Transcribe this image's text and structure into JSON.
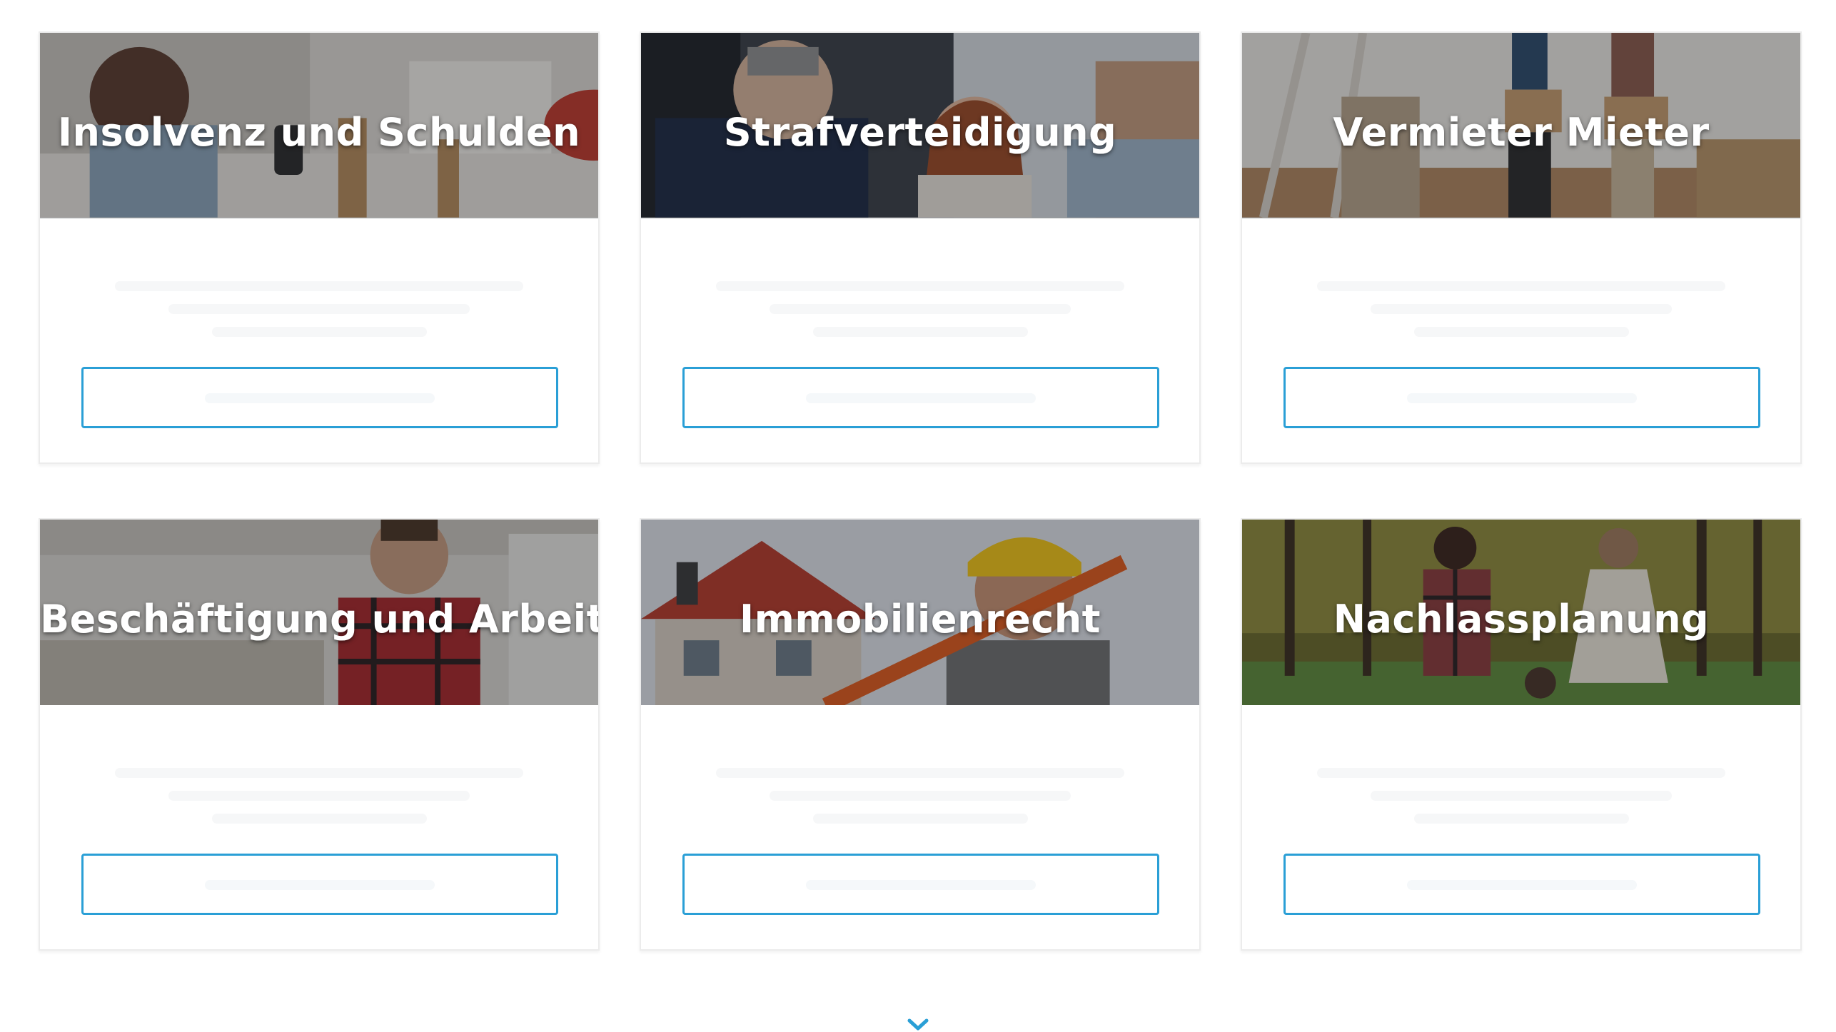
{
  "cards": [
    {
      "title": "Insolvenz und Schulden"
    },
    {
      "title": "Strafverteidigung"
    },
    {
      "title": "Vermieter Mieter"
    },
    {
      "title": "Beschäftigung und Arbeit"
    },
    {
      "title": "Immobilienrecht"
    },
    {
      "title": "Nachlassplanung"
    }
  ],
  "footer": {
    "more_icon": "chevron-down-icon"
  },
  "colors": {
    "accent": "#2a9fd6",
    "card_border": "#ececec"
  }
}
